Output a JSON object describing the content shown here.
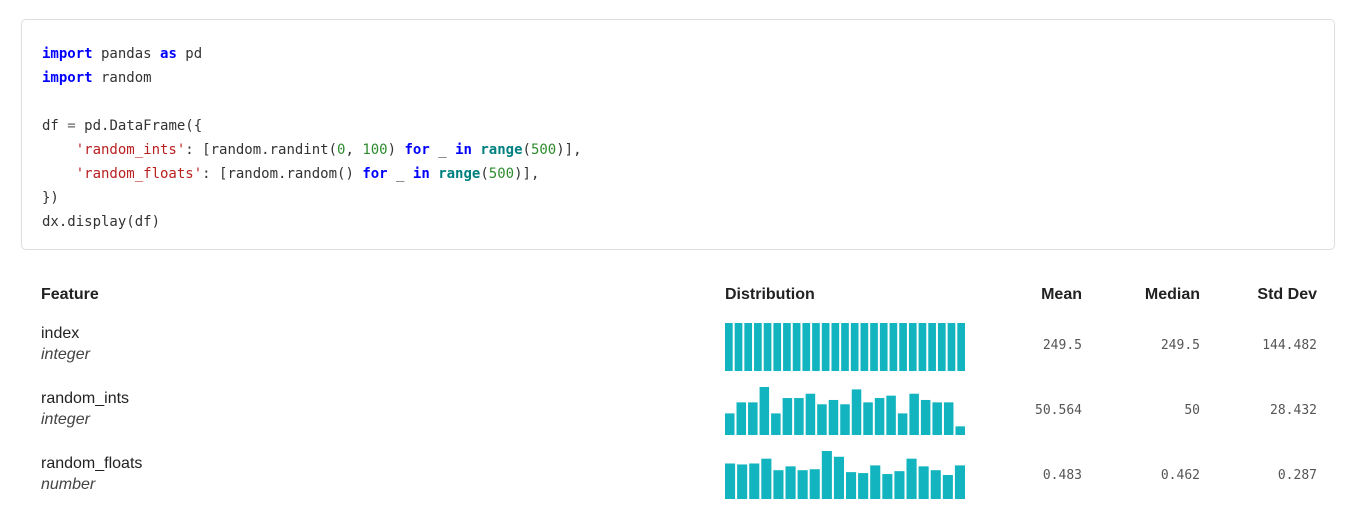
{
  "code": {
    "lines": [
      [
        {
          "t": "import",
          "c": "kw"
        },
        {
          "t": " pandas "
        },
        {
          "t": "as",
          "c": "kw"
        },
        {
          "t": " pd"
        }
      ],
      [
        {
          "t": "import",
          "c": "kw"
        },
        {
          "t": " random"
        }
      ],
      [],
      [
        {
          "t": "df "
        },
        {
          "t": "=",
          "c": "op"
        },
        {
          "t": " pd.DataFrame({"
        }
      ],
      [
        {
          "t": "    "
        },
        {
          "t": "'random_ints'",
          "c": "str"
        },
        {
          "t": ": [random.randint("
        },
        {
          "t": "0",
          "c": "num"
        },
        {
          "t": ", "
        },
        {
          "t": "100",
          "c": "num"
        },
        {
          "t": ") "
        },
        {
          "t": "for",
          "c": "kw"
        },
        {
          "t": " _ "
        },
        {
          "t": "in",
          "c": "kw"
        },
        {
          "t": " "
        },
        {
          "t": "range",
          "c": "bi"
        },
        {
          "t": "("
        },
        {
          "t": "500",
          "c": "num"
        },
        {
          "t": ")],"
        }
      ],
      [
        {
          "t": "    "
        },
        {
          "t": "'random_floats'",
          "c": "str"
        },
        {
          "t": ": [random.random() "
        },
        {
          "t": "for",
          "c": "kw"
        },
        {
          "t": " _ "
        },
        {
          "t": "in",
          "c": "kw"
        },
        {
          "t": " "
        },
        {
          "t": "range",
          "c": "bi"
        },
        {
          "t": "("
        },
        {
          "t": "500",
          "c": "num"
        },
        {
          "t": ")],"
        }
      ],
      [
        {
          "t": "})"
        }
      ],
      [
        {
          "t": "dx.display(df)"
        }
      ]
    ]
  },
  "summary": {
    "headers": {
      "feature": "Feature",
      "distribution": "Distribution",
      "mean": "Mean",
      "median": "Median",
      "std": "Std Dev"
    },
    "bar_color": "#12b5bf",
    "rows": [
      {
        "name": "index",
        "type": "integer",
        "mean": "249.5",
        "median": "249.5",
        "std": "144.482",
        "histogram": [
          1,
          1,
          1,
          1,
          1,
          1,
          1,
          1,
          1,
          1,
          1,
          1,
          1,
          1,
          1,
          1,
          1,
          1,
          1,
          1,
          1,
          1,
          1,
          1,
          1
        ]
      },
      {
        "name": "random_ints",
        "type": "integer",
        "mean": "50.564",
        "median": "50",
        "std": "28.432",
        "histogram": [
          0.45,
          0.68,
          0.68,
          1.0,
          0.45,
          0.77,
          0.77,
          0.86,
          0.64,
          0.73,
          0.64,
          0.95,
          0.68,
          0.77,
          0.82,
          0.45,
          0.86,
          0.73,
          0.68,
          0.68,
          0.18
        ]
      },
      {
        "name": "random_floats",
        "type": "number",
        "mean": "0.483",
        "median": "0.462",
        "std": "0.287",
        "histogram": [
          0.74,
          0.72,
          0.74,
          0.84,
          0.6,
          0.68,
          0.6,
          0.62,
          1.0,
          0.88,
          0.56,
          0.54,
          0.7,
          0.52,
          0.58,
          0.84,
          0.68,
          0.6,
          0.5,
          0.7
        ]
      }
    ]
  }
}
